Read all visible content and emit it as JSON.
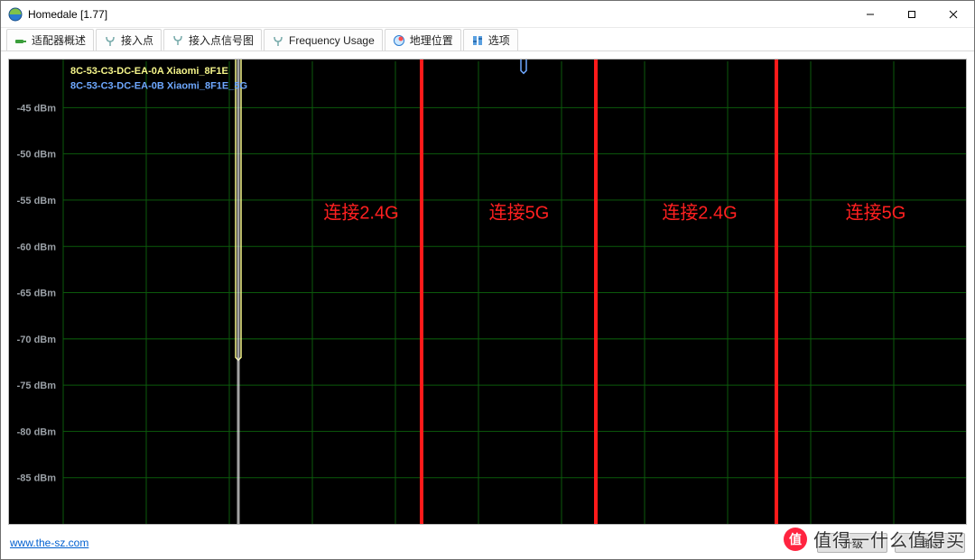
{
  "window": {
    "title": "Homedale [1.77]"
  },
  "tabs": [
    {
      "label": "适配器概述",
      "icon": "adapter-icon"
    },
    {
      "label": "接入点",
      "icon": "antenna-icon"
    },
    {
      "label": "接入点信号图",
      "icon": "antenna-icon",
      "active": true
    },
    {
      "label": "Frequency Usage",
      "icon": "antenna-icon"
    },
    {
      "label": "地理位置",
      "icon": "globe-pin-icon"
    },
    {
      "label": "选项",
      "icon": "options-icon"
    }
  ],
  "legend": [
    {
      "text": "8C-53-C3-DC-EA-0A Xiaomi_8F1E",
      "color": "#f5f58a"
    },
    {
      "text": "8C-53-C3-DC-EA-0B Xiaomi_8F1E_5G",
      "color": "#6ea8ff"
    }
  ],
  "annotations": [
    {
      "text": "连接2.4G",
      "x": 390
    },
    {
      "text": "连接5G",
      "x": 565
    },
    {
      "text": "连接2.4G",
      "x": 765
    },
    {
      "text": "连接5G",
      "x": 960
    }
  ],
  "chart_data": {
    "type": "line",
    "ylabel_unit": "dBm",
    "ylim": [
      -90,
      -40
    ],
    "ytick_step": 5,
    "xlim": [
      0,
      1045
    ],
    "grid_x_step": 92,
    "ytick_labels": [
      "-45 dBm",
      "-50 dBm",
      "-55 dBm",
      "-60 dBm",
      "-65 dBm",
      "-70 dBm",
      "-75 dBm",
      "-80 dBm",
      "-85 dBm"
    ],
    "event_markers_x": [
      457,
      650,
      850
    ],
    "series": [
      {
        "name": "8C-53-C3-DC-EA-0A Xiaomi_8F1E",
        "color": "#f5f58a",
        "spike_x": 254,
        "spike_low_dbm": -72
      },
      {
        "name": "8C-53-C3-DC-EA-0B Xiaomi_8F1E_5G",
        "color": "#6ea8ff",
        "spike_x": 570,
        "spike_low_dbm": -41
      }
    ]
  },
  "footer": {
    "link_text": "www.the-sz.com",
    "btn_upgrade": "升级",
    "btn_ok": "确定"
  },
  "watermark": {
    "text": "值得一什么值得买"
  }
}
